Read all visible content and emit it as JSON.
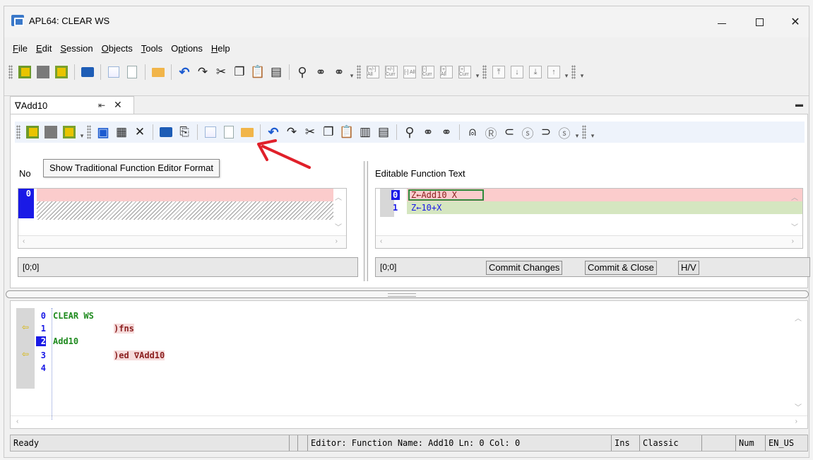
{
  "window": {
    "title": "APL64: CLEAR WS"
  },
  "menu": {
    "items": [
      {
        "label": "File",
        "u": "F",
        "rest": "ile"
      },
      {
        "label": "Edit",
        "u": "E",
        "rest": "dit"
      },
      {
        "label": "Session",
        "u": "S",
        "rest": "ession"
      },
      {
        "label": "Objects",
        "u": "O",
        "rest": "bjects"
      },
      {
        "label": "Tools",
        "u": "T",
        "rest": "ools"
      },
      {
        "label": "Options",
        "pre": "O",
        "u": "p",
        "rest": "tions"
      },
      {
        "label": "Help",
        "u": "H",
        "rest": "elp"
      }
    ]
  },
  "toolbar_main": {
    "mini_labels": [
      "[+/-] All",
      "[+/-] Curr",
      "[-] All",
      "[-] Curr",
      "[+] All",
      "[+] Curr"
    ]
  },
  "doc_tab": {
    "label": "∇Add10",
    "pin": "⇤",
    "close": "✕"
  },
  "editor": {
    "tooltip": "Show Traditional Function Editor Format",
    "left_label_fragment": "No",
    "right_label": "Editable Function Text",
    "left_line_num": "0",
    "right_lines": [
      {
        "num": "0",
        "text": "Z←Add10  X"
      },
      {
        "num": "1",
        "text": "Z←10+X"
      }
    ],
    "left_status": "[0;0]",
    "right_status": "[0;0]",
    "buttons": {
      "commit": "Commit Changes",
      "commit_close": "Commit & Close",
      "hv": "H/V"
    }
  },
  "session": {
    "lines": [
      {
        "num": "0",
        "text": "CLEAR WS",
        "style": "green",
        "indent": false
      },
      {
        "num": "1",
        "text": ")fns",
        "style": "red",
        "indent": true,
        "arrow": true
      },
      {
        "num": "2",
        "text": "Add10",
        "style": "green",
        "indent": false,
        "selected": true
      },
      {
        "num": "3",
        "text": ")ed ∇Add10",
        "style": "red",
        "indent": true,
        "arrow": true
      },
      {
        "num": "4",
        "text": "",
        "style": "green",
        "indent": false
      }
    ]
  },
  "statusbar": {
    "ready": "Ready",
    "editor_info": "Editor: Function Name: Add10 Ln: 0 Col: 0",
    "ins": "Ins",
    "mode": "Classic",
    "num": "Num",
    "locale": "EN_US"
  },
  "colors": {
    "accent_blue": "#1a1ae6",
    "annotation_red": "#e0202a",
    "code_green": "#1e8a1e",
    "code_red": "#8b1e1e"
  }
}
